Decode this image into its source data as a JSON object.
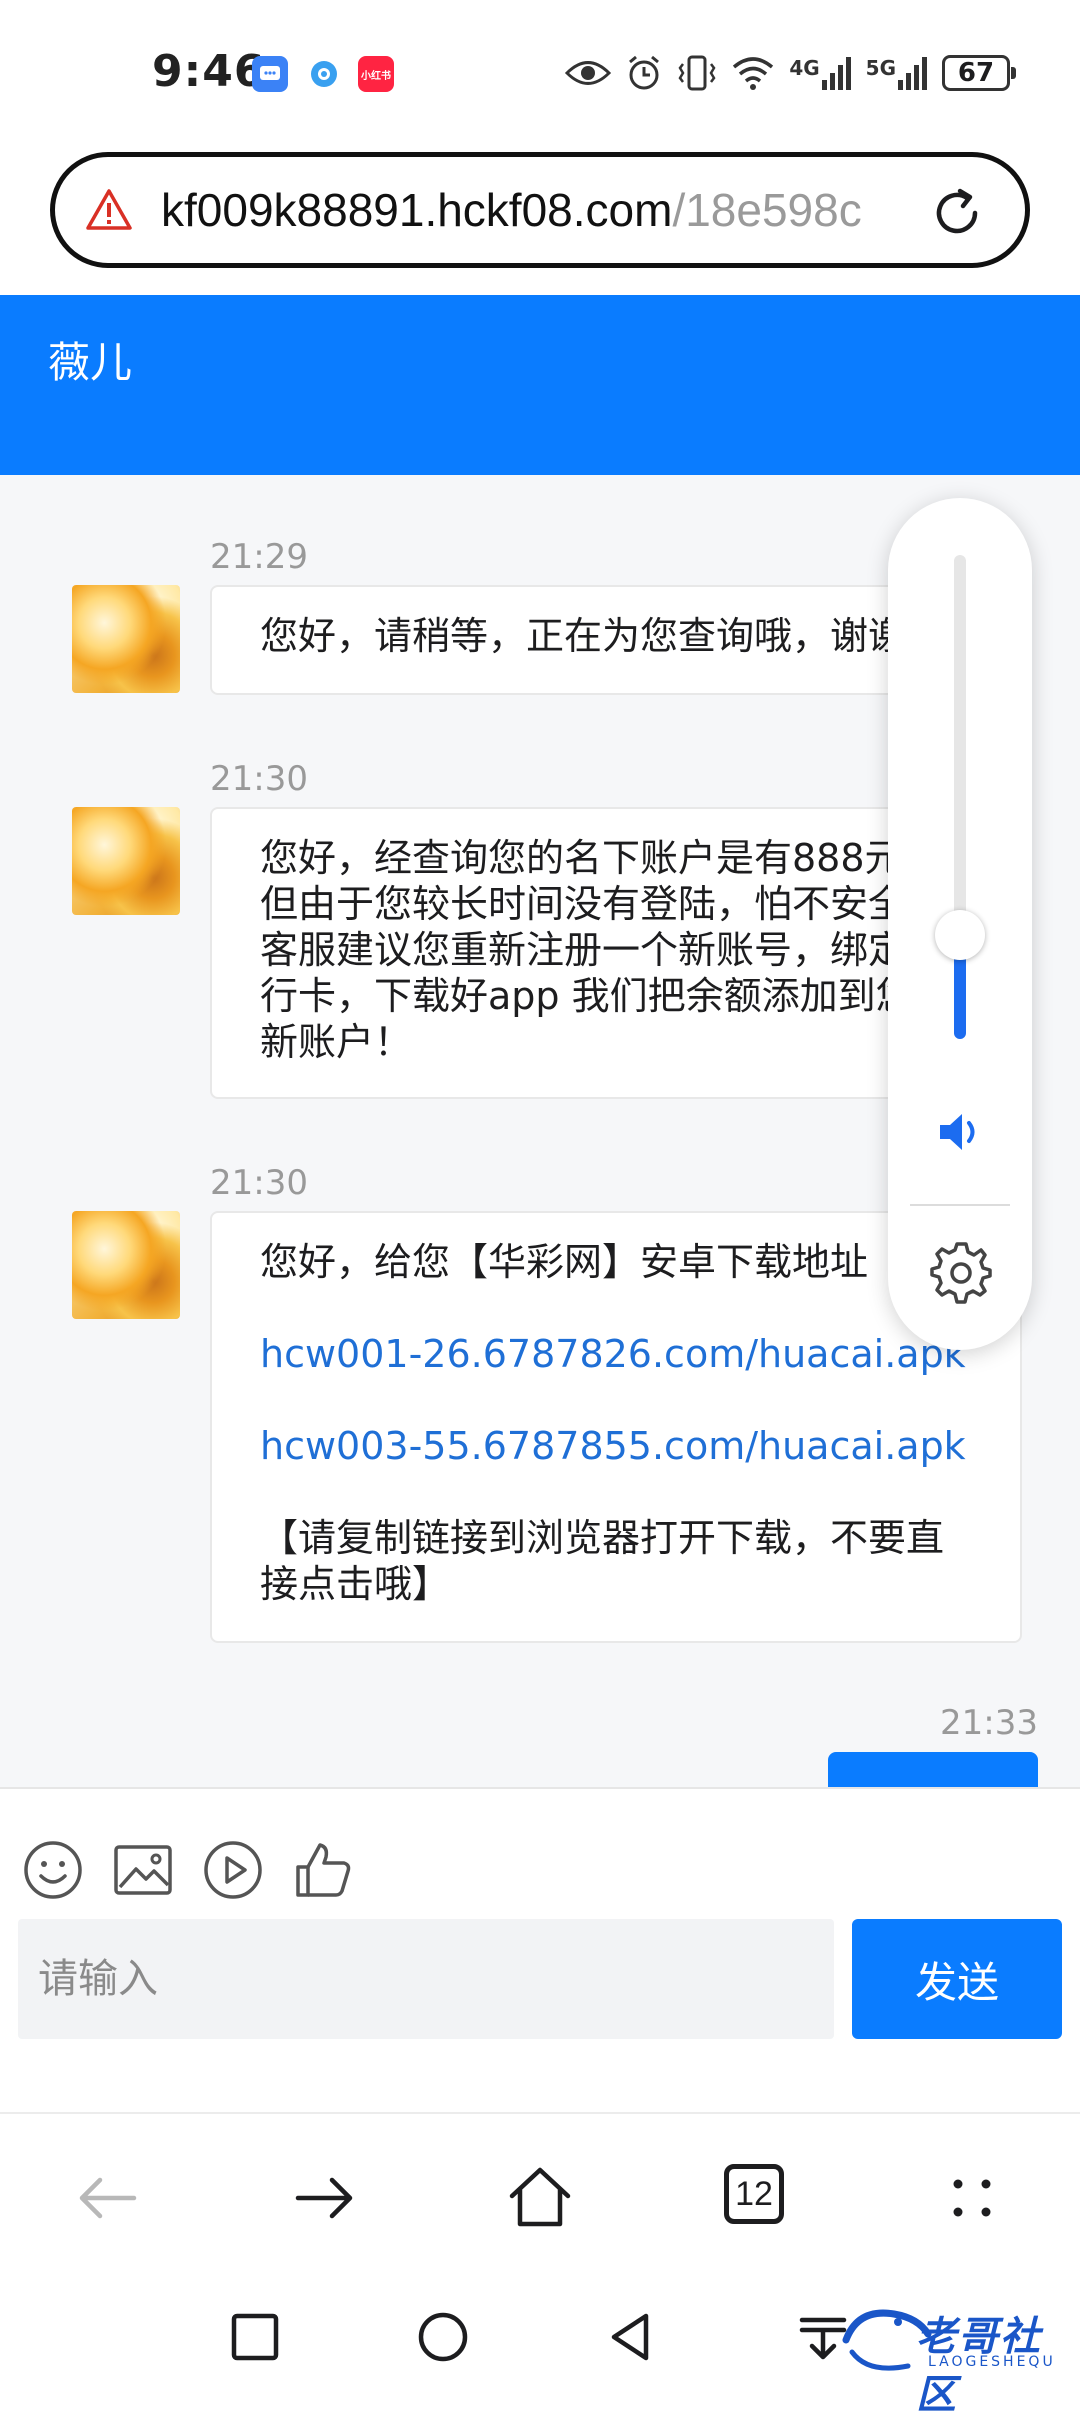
{
  "status_bar": {
    "time": "9:46",
    "battery": "67",
    "network_1": "4G",
    "network_2": "5G",
    "app_icons": [
      "chat-app-icon",
      "browser-app-icon",
      "xiaohongshu-app-icon"
    ],
    "xiaohongshu_label": "小红书"
  },
  "url_bar": {
    "host": "kf009k88891.hckf08.com",
    "path": "/18e598c"
  },
  "chat": {
    "agent_name": "薇儿",
    "messages": [
      {
        "time": "21:29",
        "lines": [
          "您好，请稍等，正在为您查询哦，谢谢！"
        ]
      },
      {
        "time": "21:30",
        "lines": [
          "您好，经查询您的名下账户是有888元，",
          "但由于您较长时间没有登陆，怕不安全，",
          "客服建议您重新注册一个新账号，绑定银",
          "行卡，下载好app 我们把余额添加到您的",
          "新账户！"
        ]
      },
      {
        "time": "21:30",
        "intro": "您好，给您【华彩网】安卓下载地址",
        "link1": "hcw001-26.6787826.com/huacai.apk",
        "link2": "hcw003-55.6787855.com/huacai.apk",
        "note_line1": "【请复制链接到浏览器打开下载，不要直",
        "note_line2": "接点击哦】"
      }
    ],
    "sent_time": "21:33"
  },
  "composer": {
    "placeholder": "请输入",
    "send_label": "发送"
  },
  "volume_overlay": {
    "level": 0.26
  },
  "browser_nav": {
    "tab_count": "12"
  },
  "watermark": {
    "title": "老哥社区",
    "subtitle": "LAOGESHEQU"
  },
  "colors": {
    "accent": "#0a7cff",
    "link": "#1f6fd6"
  }
}
